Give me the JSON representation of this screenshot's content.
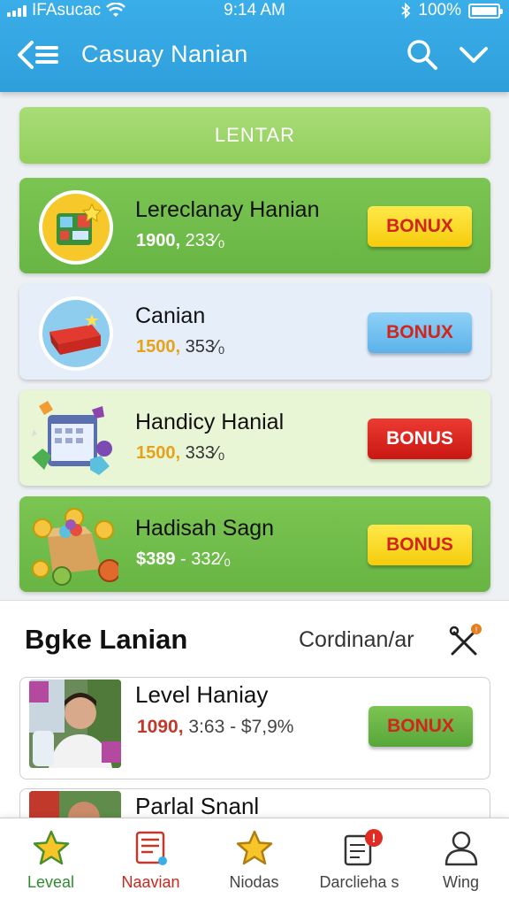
{
  "status_bar": {
    "carrier": "IFAsucac",
    "time": "9:14 AM",
    "battery": "100%"
  },
  "header": {
    "title": "Casuay Nanian"
  },
  "enter_button": "LENTAR",
  "offers": [
    {
      "title": "Lereclanay Hanian",
      "meta_accent": "1900,",
      "meta_rest": " 233⁄₀",
      "bonus": "BONUX",
      "card_style": "green",
      "bonus_style": "yellow",
      "icon": "calculator-gift-icon"
    },
    {
      "title": "Canian",
      "meta_accent": "1500,",
      "meta_rest": " 353⁄₀",
      "bonus": "BONUX",
      "card_style": "blue",
      "bonus_style": "blue",
      "icon": "red-toolbox-icon"
    },
    {
      "title": "Handicy Hanial",
      "meta_accent": "1500,",
      "meta_rest": " 333⁄₀",
      "bonus": "BONUS",
      "card_style": "lime",
      "bonus_style": "red",
      "icon": "calendar-gems-icon"
    },
    {
      "title": "Hadisah Sagn",
      "meta_accent": "$389",
      "meta_rest": " - 332⁄₀",
      "bonus": "BONUS",
      "card_style": "green",
      "bonus_style": "yellow",
      "icon": "coin-box-icon"
    }
  ],
  "lower_section": {
    "title": "Bgke Lanian",
    "link": "Cordinan/ar",
    "tools_icon": "tools-icon",
    "cards": [
      {
        "title": "Level Haniay",
        "meta_accent": "1090,",
        "meta_rest": " 3:63 - $7,9%",
        "bonus": "BONUX"
      },
      {
        "title": "Parlal Snanl",
        "meta_accent": "",
        "meta_rest": "",
        "bonus": ""
      }
    ]
  },
  "tabs": [
    {
      "label": "Leveal",
      "icon": "star-icon",
      "active": false
    },
    {
      "label": "Naavian",
      "icon": "news-icon",
      "active": true
    },
    {
      "label": "Niodas",
      "icon": "star-outline-icon",
      "active": false
    },
    {
      "label": "Darclieha s",
      "icon": "notes-icon",
      "badge": "!",
      "active": false
    },
    {
      "label": "Wing",
      "icon": "user-icon",
      "active": false
    }
  ],
  "colors": {
    "header_blue": "#2f9fdc",
    "green": "#6cb848",
    "bonus_yellow": "#f5cc0c",
    "bonus_red": "#d0261b"
  }
}
